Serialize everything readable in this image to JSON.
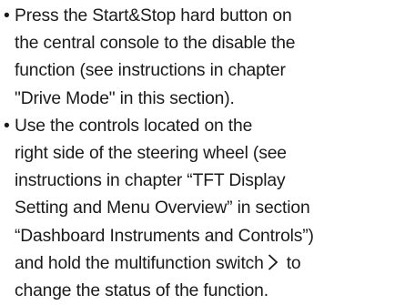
{
  "instructions": {
    "bullet_symbol": "•",
    "items": [
      {
        "lines": [
          "Press the Start&Stop hard button on",
          "the central console to the disable the",
          "function (see instructions in chapter",
          "\"Drive Mode\" in this section)."
        ]
      },
      {
        "lines": [
          "Use the controls located on the",
          "right side of the steering wheel (see",
          "instructions in chapter “TFT Display",
          "Setting and Menu Overview” in section",
          "“Dashboard Instruments and Controls”)",
          "and hold the multifunction switch",
          "to",
          "change the status of the function."
        ],
        "inline_icon": "chevron-right-icon"
      }
    ]
  }
}
